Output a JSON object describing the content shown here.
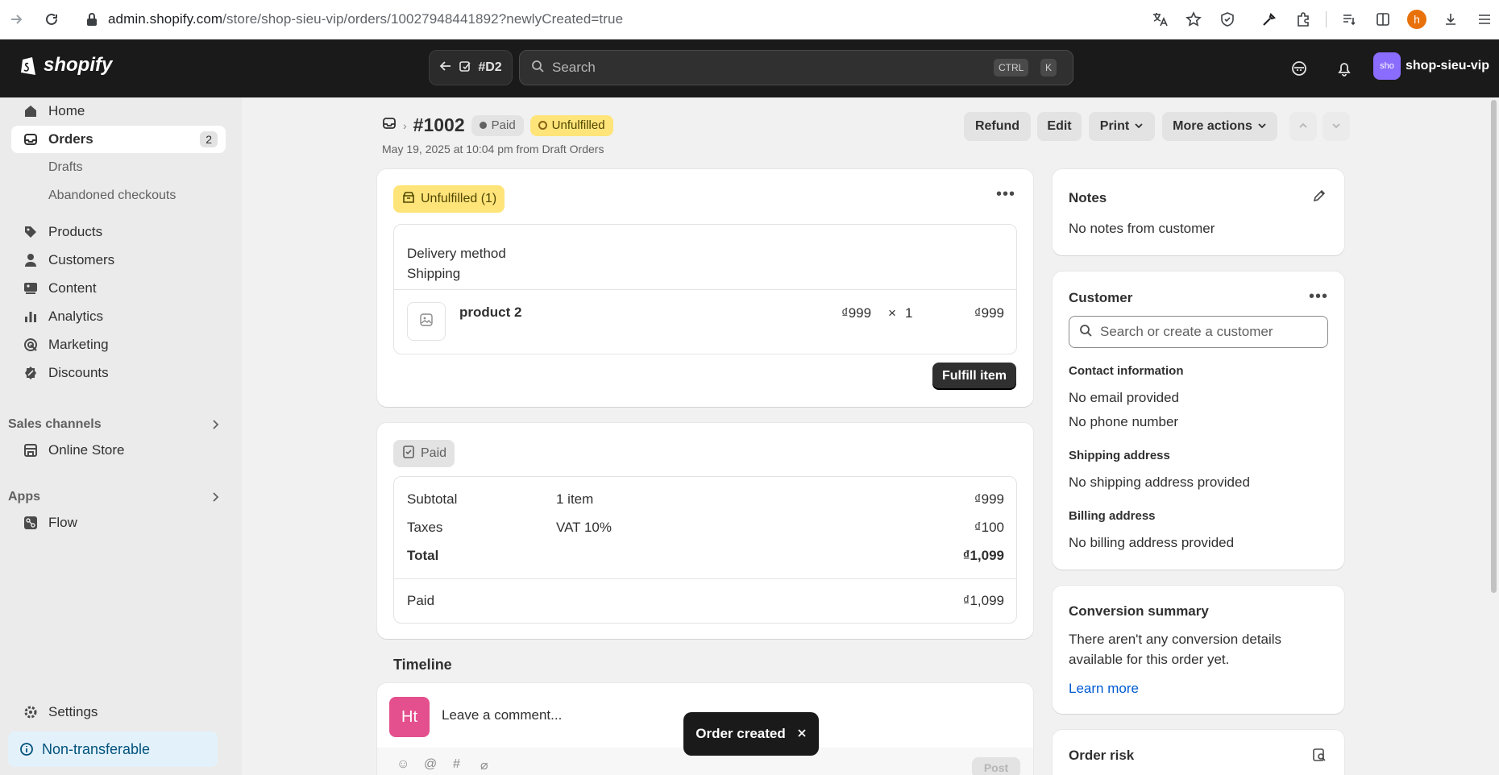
{
  "browser": {
    "url_host": "admin.shopify.com",
    "url_path": "/store/shop-sieu-vip/orders/10027948441892?newlyCreated=true",
    "profile_initial": "h"
  },
  "topbar": {
    "logo_text": "shopify",
    "order_chip": "#D2",
    "search_placeholder": "Search",
    "kbd_ctrl": "CTRL",
    "kbd_k": "K",
    "store_avatar": "sho",
    "store_name": "shop-sieu-vip"
  },
  "sidebar": {
    "home": "Home",
    "orders": "Orders",
    "orders_count": "2",
    "drafts": "Drafts",
    "abandoned": "Abandoned checkouts",
    "products": "Products",
    "customers": "Customers",
    "content": "Content",
    "analytics": "Analytics",
    "marketing": "Marketing",
    "discounts": "Discounts",
    "sales_channels": "Sales channels",
    "online_store": "Online Store",
    "apps": "Apps",
    "flow": "Flow",
    "settings": "Settings",
    "non_transferable": "Non-transferable"
  },
  "header": {
    "order_number": "#1002",
    "badge_paid": "Paid",
    "badge_unfulfilled": "Unfulfilled",
    "subtitle": "May 19, 2025 at 10:04 pm from Draft Orders",
    "refund": "Refund",
    "edit": "Edit",
    "print": "Print",
    "more_actions": "More actions"
  },
  "fulfillment": {
    "badge": "Unfulfilled (1)",
    "delivery_label": "Delivery method",
    "delivery_value": "Shipping",
    "product_name": "product 2",
    "unit_price": "₫999",
    "times": "×",
    "qty": "1",
    "line_total": "₫999",
    "fulfill_button": "Fulfill item"
  },
  "payment": {
    "badge": "Paid",
    "subtotal_label": "Subtotal",
    "subtotal_desc": "1 item",
    "subtotal_value": "₫999",
    "taxes_label": "Taxes",
    "taxes_desc": "VAT 10%",
    "taxes_value": "₫100",
    "total_label": "Total",
    "total_value": "₫1,099",
    "paid_label": "Paid",
    "paid_value": "₫1,099"
  },
  "timeline": {
    "title": "Timeline",
    "avatar": "Ht",
    "comment_placeholder": "Leave a comment...",
    "post": "Post"
  },
  "notes": {
    "title": "Notes",
    "body": "No notes from customer"
  },
  "customer": {
    "title": "Customer",
    "search_placeholder": "Search or create a customer",
    "contact_title": "Contact information",
    "no_email": "No email provided",
    "no_phone": "No phone number",
    "shipping_title": "Shipping address",
    "shipping_body": "No shipping address provided",
    "billing_title": "Billing address",
    "billing_body": "No billing address provided"
  },
  "conversion": {
    "title": "Conversion summary",
    "body_line1": "There aren't any conversion details",
    "body_line2": "available for this order yet.",
    "learn_more": "Learn more"
  },
  "order_risk": {
    "title": "Order risk"
  },
  "toast": {
    "text": "Order created"
  }
}
